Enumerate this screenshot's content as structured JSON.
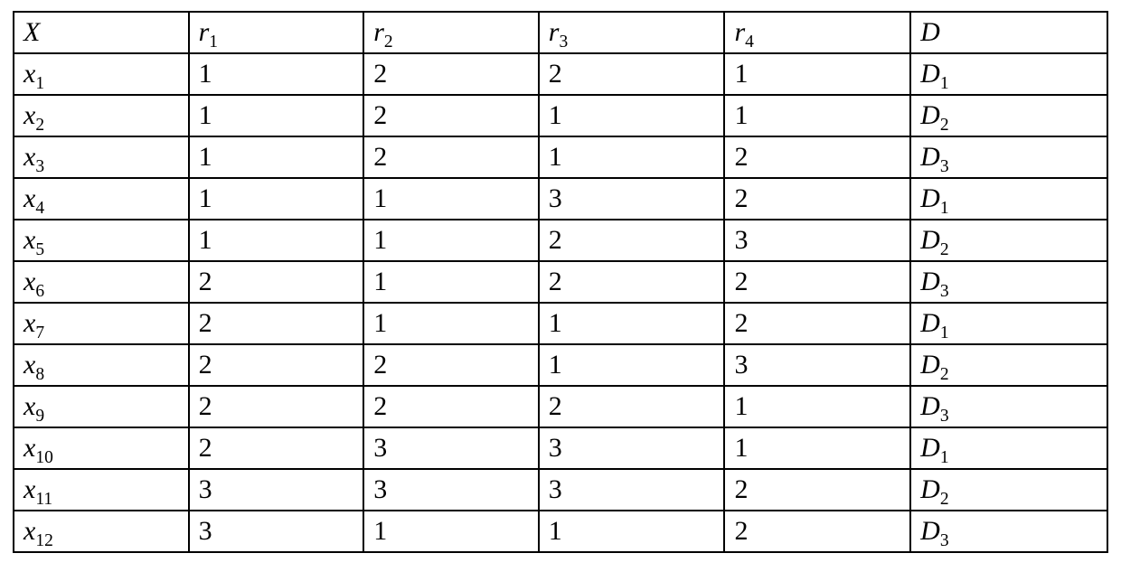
{
  "table": {
    "headers": [
      {
        "var": "X",
        "sub": ""
      },
      {
        "var": "r",
        "sub": "1"
      },
      {
        "var": "r",
        "sub": "2"
      },
      {
        "var": "r",
        "sub": "3"
      },
      {
        "var": "r",
        "sub": "4"
      },
      {
        "var": "D",
        "sub": ""
      }
    ],
    "rows": [
      {
        "label": {
          "var": "x",
          "sub": "1"
        },
        "r1": "1",
        "r2": "2",
        "r3": "2",
        "r4": "1",
        "d": {
          "var": "D",
          "sub": "1"
        }
      },
      {
        "label": {
          "var": "x",
          "sub": "2"
        },
        "r1": "1",
        "r2": "2",
        "r3": "1",
        "r4": "1",
        "d": {
          "var": "D",
          "sub": "2"
        }
      },
      {
        "label": {
          "var": "x",
          "sub": "3"
        },
        "r1": "1",
        "r2": "2",
        "r3": "1",
        "r4": "2",
        "d": {
          "var": "D",
          "sub": "3"
        }
      },
      {
        "label": {
          "var": "x",
          "sub": "4"
        },
        "r1": "1",
        "r2": "1",
        "r3": "3",
        "r4": "2",
        "d": {
          "var": "D",
          "sub": "1"
        }
      },
      {
        "label": {
          "var": "x",
          "sub": "5"
        },
        "r1": "1",
        "r2": "1",
        "r3": "2",
        "r4": "3",
        "d": {
          "var": "D",
          "sub": "2"
        }
      },
      {
        "label": {
          "var": "x",
          "sub": "6"
        },
        "r1": "2",
        "r2": "1",
        "r3": "2",
        "r4": "2",
        "d": {
          "var": "D",
          "sub": "3"
        }
      },
      {
        "label": {
          "var": "x",
          "sub": "7"
        },
        "r1": "2",
        "r2": "1",
        "r3": "1",
        "r4": "2",
        "d": {
          "var": "D",
          "sub": "1"
        }
      },
      {
        "label": {
          "var": "x",
          "sub": "8"
        },
        "r1": "2",
        "r2": "2",
        "r3": "1",
        "r4": "3",
        "d": {
          "var": "D",
          "sub": "2"
        }
      },
      {
        "label": {
          "var": "x",
          "sub": "9"
        },
        "r1": "2",
        "r2": "2",
        "r3": "2",
        "r4": "1",
        "d": {
          "var": "D",
          "sub": "3"
        }
      },
      {
        "label": {
          "var": "x",
          "sub": "10"
        },
        "r1": "2",
        "r2": "3",
        "r3": "3",
        "r4": "1",
        "d": {
          "var": "D",
          "sub": "1"
        }
      },
      {
        "label": {
          "var": "x",
          "sub": "11"
        },
        "r1": "3",
        "r2": "3",
        "r3": "3",
        "r4": "2",
        "d": {
          "var": "D",
          "sub": "2"
        }
      },
      {
        "label": {
          "var": "x",
          "sub": "12"
        },
        "r1": "3",
        "r2": "1",
        "r3": "1",
        "r4": "2",
        "d": {
          "var": "D",
          "sub": "3"
        }
      }
    ]
  }
}
